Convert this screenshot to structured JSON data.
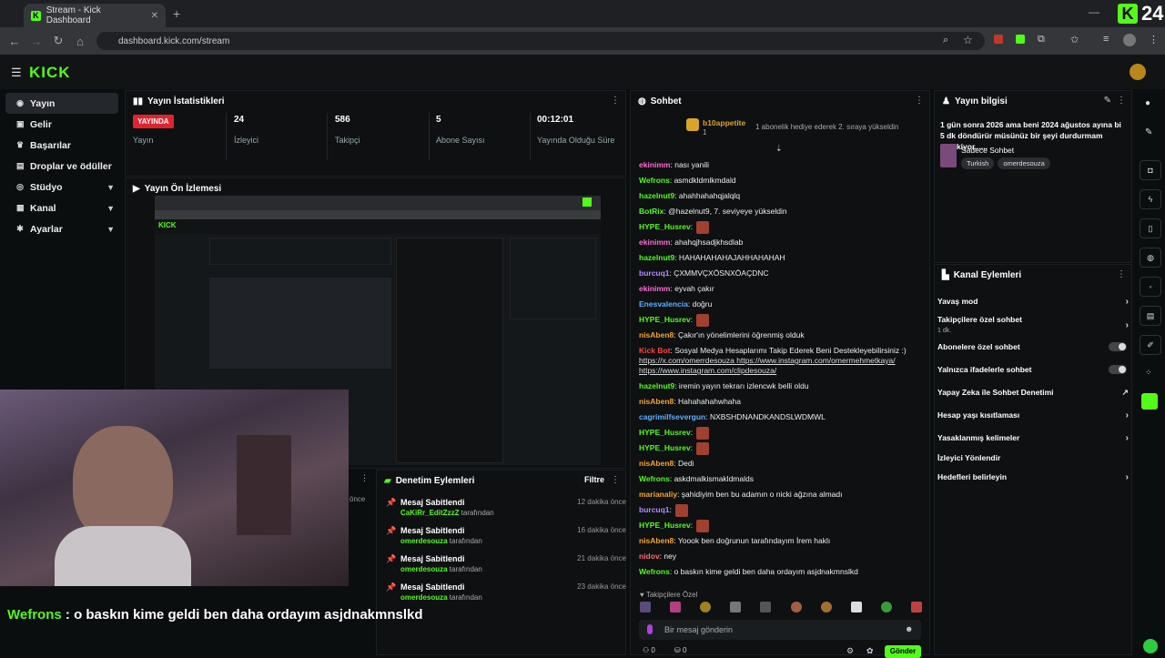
{
  "browser": {
    "tab_title": "Stream - Kick Dashboard",
    "url": "dashboard.kick.com/stream",
    "overlay_badge": "24"
  },
  "app": {
    "logo": "KICK"
  },
  "sidebar": {
    "items": [
      {
        "label": "Yayın",
        "icon": "broadcast-icon",
        "active": true
      },
      {
        "label": "Gelir",
        "icon": "revenue-icon"
      },
      {
        "label": "Başarılar",
        "icon": "trophy-icon"
      },
      {
        "label": "Droplar ve ödüller",
        "icon": "gift-icon"
      },
      {
        "label": "Stüdyo",
        "icon": "studio-icon",
        "expandable": true
      },
      {
        "label": "Kanal",
        "icon": "channel-icon",
        "expandable": true
      },
      {
        "label": "Ayarlar",
        "icon": "settings-icon",
        "expandable": true
      }
    ]
  },
  "stats": {
    "title": "Yayın İstatistikleri",
    "status_badge": "YAYINDA",
    "status_label": "Yayın",
    "viewers_value": "24",
    "viewers_label": "İzleyici",
    "followers_value": "586",
    "followers_label": "Takipçi",
    "subs_value": "5",
    "subs_label": "Abone Sayısı",
    "uptime_value": "00:12:01",
    "uptime_label": "Yayında Olduğu Süre"
  },
  "preview": {
    "title": "Yayın Ön İzlemesi"
  },
  "subtitle": {
    "name": "Wefrons",
    "text": " : o baskın kime geldi ben daha ordayım asjdnakmnslkd"
  },
  "moderation": {
    "title": "Denetim Eylemleri",
    "filter": "Filtre",
    "partial_time": "önce",
    "rows": [
      {
        "title": "Mesaj Sabitlendi",
        "user": "CaKiRr_EditZzzZ",
        "suffix": " tarafından",
        "time": "12 dakika önce"
      },
      {
        "title": "Mesaj Sabitlendi",
        "user": "omerdesouza",
        "suffix": " tarafından",
        "time": "16 dakika önce"
      },
      {
        "title": "Mesaj Sabitlendi",
        "user": "omerdesouza",
        "suffix": " tarafından",
        "time": "21 dakika önce"
      },
      {
        "title": "Mesaj Sabitlendi",
        "user": "omerdesouza",
        "suffix": " tarafından",
        "time": "23 dakika önce"
      }
    ]
  },
  "chat": {
    "title": "Sohbet",
    "pinned_user": "b10appetite",
    "pinned_count": "1",
    "pinned_text": "1 abonelik hediye ederek 2. sıraya yükseldin",
    "messages": [
      {
        "name": "ekinimm",
        "color": "#ff6ad5",
        "text": ": nası yanili"
      },
      {
        "name": "Wefrons",
        "color": "#53fc18",
        "text": ": asmdkldmlkmdald"
      },
      {
        "name": "hazelnut9",
        "color": "#53fc18",
        "text": ": ahahhahahqjalqlq"
      },
      {
        "name": "BotRix",
        "color": "#53fc18",
        "text": ": @hazelnut9, 7. seviyeye yükseldin"
      },
      {
        "name": "HYPE_Husrev",
        "color": "#53fc18",
        "text": ":"
      },
      {
        "name": "ekinimm",
        "color": "#ff6ad5",
        "text": ": ahahqjhsadjkhsdlab"
      },
      {
        "name": "hazelnut9",
        "color": "#53fc18",
        "text": ": HAHAHAHAHAJAHHAHAHAH"
      },
      {
        "name": "burcuq1",
        "color": "#b18cff",
        "text": ": ÇXMMVÇXÖSNXÖAÇDNC"
      },
      {
        "name": "ekinimm",
        "color": "#ff6ad5",
        "text": ": eyvah çakır"
      },
      {
        "name": "Enesvalencia",
        "color": "#5fb0ff",
        "text": ": doğru"
      },
      {
        "name": "HYPE_Husrev",
        "color": "#53fc18",
        "text": ":"
      },
      {
        "name": "nisAben8",
        "color": "#f5a623",
        "text": ": Çakır'ın yönelimlerini öğrenmiş olduk"
      }
    ],
    "long_msg": {
      "name": "Kick Bot",
      "text": ": Sosyal Medya Hesaplarımı Takip Ederek Beni Destekleyebilirsiniz :)",
      "link1": "https://x.com/omerrdesouza",
      "link2": "https://www.instagram.com/omermehmetkaya/",
      "link3": "https://www.instagram.com/clipdesouza/"
    },
    "messages2": [
      {
        "name": "hazelnut9",
        "color": "#53fc18",
        "text": ": iremin yayın tekrarı izlencwk belli oldu"
      },
      {
        "name": "nisAben8",
        "color": "#f5a623",
        "text": ": Hahahahahwhaha"
      },
      {
        "name": "cagrimilfsevergun",
        "color": "#5fb0ff",
        "text": ": NXBSHDNANDKANDSLWDMWL"
      },
      {
        "name": "HYPE_Husrev",
        "color": "#53fc18",
        "text": ":"
      },
      {
        "name": "HYPE_Husrev",
        "color": "#53fc18",
        "text": ":"
      },
      {
        "name": "nisAben8",
        "color": "#f5a623",
        "text": ": Dedi"
      },
      {
        "name": "Wefrons",
        "color": "#53fc18",
        "text": ": askdmalkismakldmalds"
      },
      {
        "name": "marianaliy",
        "color": "#f5a623",
        "text": ": şahidiyim ben bu adamın o nicki ağzına almadı"
      },
      {
        "name": "burcuq1",
        "color": "#b18cff",
        "text": ":"
      },
      {
        "name": "HYPE_Husrev",
        "color": "#53fc18",
        "text": ":"
      },
      {
        "name": "nisAben8",
        "color": "#f5a623",
        "text": ": Yoook ben doğrunun tarafındayım İrem haklı"
      },
      {
        "name": "nidov",
        "color": "#ff6a6a",
        "text": ": ney"
      },
      {
        "name": "Wefrons",
        "color": "#53fc18",
        "text": ": o baskın kime geldi ben daha ordayım asjdnakmnslkd"
      }
    ],
    "followers_only": "Takipçilere Özel",
    "input_placeholder": "Bir mesaj gönderin",
    "send_label": "Gönder",
    "footer_count1": "0",
    "footer_count2": "0"
  },
  "stream_info": {
    "title": "Yayın bilgisi",
    "stream_title": "1 gün sonra 2026 ama beni 2024 ağustos ayına bi 5 dk döndürür müsünüz bir şeyi durdurmam gerekiyor......",
    "category": "Sadece Sohbet",
    "tags": [
      "Turkish",
      "omerdesouza"
    ]
  },
  "channel_actions": {
    "title": "Kanal Eylemleri",
    "rows": [
      {
        "label": "Yavaş mod",
        "control": "chevron"
      },
      {
        "label": "Takipçilere özel sohbet",
        "sub": "1 dk.",
        "control": "chevron"
      },
      {
        "label": "Abonelere özel sohbet",
        "control": "toggle"
      },
      {
        "label": "Yalnızca ifadelerle sohbet",
        "control": "toggle"
      },
      {
        "label": "Yapay Zeka ile Sohbet Denetimi",
        "control": "external"
      },
      {
        "label": "Hesap yaşı kısıtlaması",
        "control": "chevron"
      },
      {
        "label": "Yasaklanmış kelimeler",
        "control": "chevron"
      },
      {
        "label": "İzleyici Yönlendir",
        "control": "none"
      },
      {
        "label": "Hedefleri belirleyin",
        "control": "chevron"
      }
    ]
  },
  "colors": {
    "accent": "#53fc18",
    "live": "#e0242f"
  }
}
